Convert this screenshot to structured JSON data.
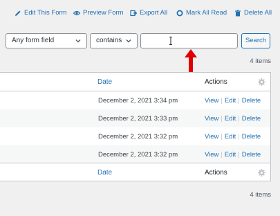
{
  "toolbar": {
    "items": [
      {
        "label": "Edit This Form",
        "icon": "pencil-icon"
      },
      {
        "label": "Preview Form",
        "icon": "eye-icon"
      },
      {
        "label": "Export All",
        "icon": "export-icon"
      },
      {
        "label": "Mark All Read",
        "icon": "circle-icon"
      },
      {
        "label": "Delete All",
        "icon": "trash-icon"
      }
    ]
  },
  "filters": {
    "field_select": "Any form field",
    "operator_select": "contains",
    "search_value": "",
    "search_button": "Search"
  },
  "top_count": "4 items",
  "bottom_count": "4 items",
  "table": {
    "columns": {
      "date": "Date",
      "actions": "Actions"
    },
    "rows": [
      {
        "date": "December 2, 2021 3:34 pm",
        "view": "View",
        "edit": "Edit",
        "delete": "Delete"
      },
      {
        "date": "December 2, 2021 3:33 pm",
        "view": "View",
        "edit": "Edit",
        "delete": "Delete"
      },
      {
        "date": "December 2, 2021 3:32 pm",
        "view": "View",
        "edit": "Edit",
        "delete": "Delete"
      },
      {
        "date": "December 2, 2021 3:32 pm",
        "view": "View",
        "edit": "Edit",
        "delete": "Delete"
      }
    ],
    "separator": "|"
  },
  "colors": {
    "link": "#2271b1",
    "arrow": "#e00000",
    "alt_row": "#f6f7f7"
  }
}
